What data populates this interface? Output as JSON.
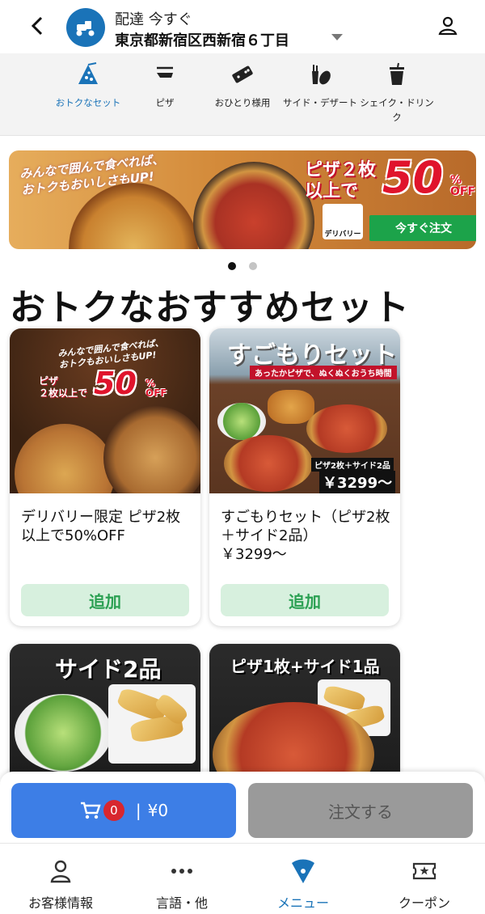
{
  "header": {
    "delivery_mode": "配達 今すぐ",
    "address": "東京都新宿区西新宿６丁目",
    "icons": {
      "back": "back-arrow-icon",
      "scooter": "scooter-icon",
      "caret": "caret-down-icon",
      "account": "account-icon"
    }
  },
  "categories": [
    {
      "label": "おトクなセット",
      "icon": "pizza-slice-icon",
      "active": true
    },
    {
      "label": "ピザ",
      "icon": "pizza-icon",
      "active": false
    },
    {
      "label": "おひとり様用",
      "icon": "domino-icon",
      "active": false
    },
    {
      "label": "サイド・デザート",
      "icon": "side-dessert-icon",
      "active": false
    },
    {
      "label": "シェイク・ドリンク",
      "icon": "drink-icon",
      "active": false
    }
  ],
  "banner": {
    "headline_line1": "みんなで囲んで食べれば、",
    "headline_line2": "おトクもおいしさもUP!",
    "promo_line1": "ピザ２枚",
    "promo_line2": "以上で",
    "discount": "50",
    "discount_unit_top": "%",
    "discount_unit_bottom": "OFF",
    "delivery_label": "デリバリー",
    "cta": "今すぐ注文"
  },
  "carousel": {
    "current": 1,
    "total": 2
  },
  "section_title": "おトクなおすすめセット",
  "cards": [
    {
      "name": "デリバリー限定 ピザ2枚以上で50%OFF",
      "add_label": "追加",
      "image": {
        "headline_line1": "みんなで囲んで食べれば、",
        "headline_line2": "おトクもおいしさもUP!",
        "promo_line1": "ピザ",
        "promo_line2": "２枚以上で",
        "discount": "50",
        "discount_unit_top": "%",
        "discount_unit_bottom": "OFF"
      }
    },
    {
      "name": "すごもりセット（ピザ2枚＋サイド2品）\n￥3299〜",
      "add_label": "追加",
      "image": {
        "headline": "すごもりセット",
        "sub": "あったかピザで、ぬくぬくおうち時間",
        "caption": "ピザ2枚＋サイド2品",
        "price": "￥3299〜"
      }
    },
    {
      "name": "",
      "add_label": "",
      "image": {
        "headline": "サイド2品"
      }
    },
    {
      "name": "",
      "add_label": "",
      "image": {
        "headline": "ピザ1枚+サイド1品"
      }
    }
  ],
  "cart": {
    "count": "0",
    "separator": "|",
    "total": "¥0",
    "order_label": "注文する"
  },
  "bottom_nav": [
    {
      "label": "お客様情報",
      "icon": "person-icon",
      "active": false
    },
    {
      "label": "言語・他",
      "icon": "more-dots-icon",
      "active": false
    },
    {
      "label": "メニュー",
      "icon": "menu-pizza-icon",
      "active": true
    },
    {
      "label": "クーポン",
      "icon": "coupon-ticket-icon",
      "active": false
    }
  ],
  "colors": {
    "accent": "#1a73b8",
    "cta_green": "#1ca34a",
    "add_bg": "#d7f0de",
    "cart_blue": "#3d7ee6",
    "badge_red": "#d8262e",
    "disabled_gray": "#9a9a9a"
  }
}
